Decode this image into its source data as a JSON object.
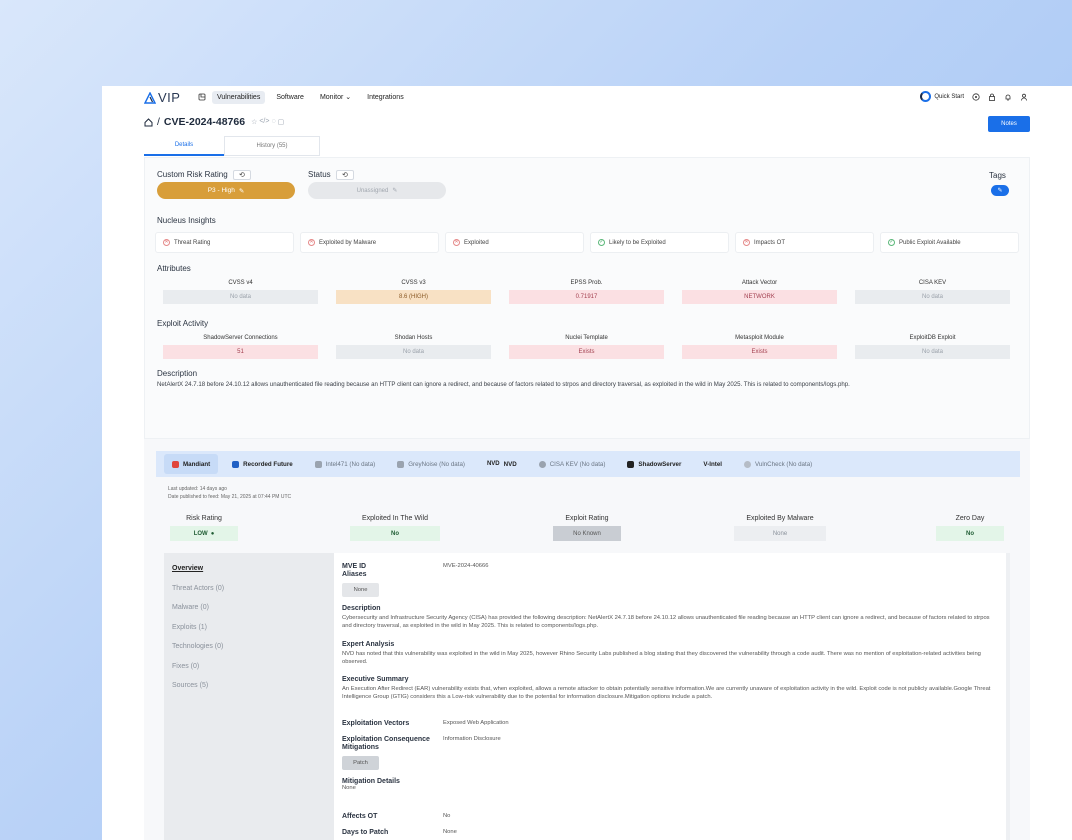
{
  "app": {
    "brand": "VIP"
  },
  "nav": {
    "items": [
      "Vulnerabilities",
      "Software",
      "Monitor",
      "Integrations"
    ],
    "quick_start": "Quick Start"
  },
  "header": {
    "cve_id": "CVE-2024-48766",
    "notes_label": "Notes"
  },
  "tabs": [
    {
      "label": "Details"
    },
    {
      "label": "History (55)"
    }
  ],
  "details": {
    "custom_risk_label": "Custom Risk Rating",
    "custom_risk_value": "P3 - High",
    "status_label": "Status",
    "status_value": "Unassigned",
    "tags_label": "Tags",
    "insights_label": "Nucleus Insights",
    "insights": [
      {
        "label": "Threat Rating",
        "state": "no"
      },
      {
        "label": "Exploited by Malware",
        "state": "no"
      },
      {
        "label": "Exploited",
        "state": "no"
      },
      {
        "label": "Likely to be Exploited",
        "state": "yes"
      },
      {
        "label": "Impacts OT",
        "state": "no"
      },
      {
        "label": "Public Exploit Available",
        "state": "yes"
      }
    ],
    "attributes_label": "Attributes",
    "attributes": [
      {
        "label": "CVSS v4",
        "value": "No data"
      },
      {
        "label": "CVSS v3",
        "value": "8.6 (HIGH)"
      },
      {
        "label": "EPSS Prob.",
        "value": "0.71917"
      },
      {
        "label": "Attack Vector",
        "value": "NETWORK"
      },
      {
        "label": "CISA KEV",
        "value": "No data"
      }
    ],
    "exploit_label": "Exploit Activity",
    "exploit": [
      {
        "label": "ShadowServer Connections",
        "value": "51"
      },
      {
        "label": "Shodan Hosts",
        "value": "No data"
      },
      {
        "label": "Nuclei Template",
        "value": "Exists"
      },
      {
        "label": "Metasploit Module",
        "value": "Exists"
      },
      {
        "label": "ExploitDB Exploit",
        "value": "No data"
      }
    ],
    "description_label": "Description",
    "description": "NetAlertX 24.7.18 before 24.10.12 allows unauthenticated file reading because an HTTP client can ignore a redirect, and because of factors related to strpos and directory traversal, as exploited in the wild in May 2025. This is related to components/logs.php."
  },
  "sources": {
    "tabs": [
      "Mandiant",
      "Recorded Future",
      "Intel471 (No data)",
      "GreyNoise (No data)",
      "NVD",
      "CISA KEV (No data)",
      "ShadowServer",
      "V-Intel",
      "VulnCheck (No data)"
    ],
    "last_updated": "Last updated: 14 days ago",
    "published": "Date published to feed: May 21, 2025 at 07:44 PM UTC",
    "ratings": [
      {
        "label": "Risk Rating",
        "value": "LOW"
      },
      {
        "label": "Exploited In The Wild",
        "value": "No"
      },
      {
        "label": "Exploit Rating",
        "value": "No Known"
      },
      {
        "label": "Exploited By Malware",
        "value": "None"
      },
      {
        "label": "Zero Day",
        "value": "No"
      }
    ],
    "sidenav": [
      "Overview",
      "Threat Actors (0)",
      "Malware (0)",
      "Exploits (1)",
      "Technologies (0)",
      "Fixes (0)",
      "Sources (5)"
    ],
    "overview": {
      "mve_id_label": "MVE ID",
      "mve_id": "MVE-2024-40666",
      "aliases_label": "Aliases",
      "aliases": "None",
      "description_label": "Description",
      "description": "Cybersecurity and Infrastructure Security Agency (CISA) has provided the following description: NetAlertX 24.7.18 before 24.10.12 allows unauthenticated file reading because an HTTP client can ignore a redirect, and because of factors related to strpos and directory traversal, as exploited in the wild in May 2025. This is related to components/logs.php.",
      "expert_label": "Expert Analysis",
      "expert": "NVD has noted that this vulnerability was exploited in the wild in May 2025, however Rhino Security Labs published a blog stating that they discovered the vulnerability through a code audit. There was no mention of exploitation-related activities being observed.",
      "exec_label": "Executive Summary",
      "exec": "An Execution After Redirect (EAR) vulnerability exists that, when exploited, allows a remote attacker to obtain potentially sensitive information.We are currently unaware of exploitation activity in the wild. Exploit code is not publicly available.Google Threat Intelligence Group (GTIG) considers this a Low-risk vulnerability due to the potential for information disclosure.Mitigation options include a patch.",
      "vectors_label": "Exploitation Vectors",
      "vectors": "Exposed Web Application",
      "consequence_label": "Exploitation Consequence",
      "consequence": "Information Disclosure",
      "mitigations_label": "Mitigations",
      "mitigations": "Patch",
      "mit_details_label": "Mitigation Details",
      "mit_details": "None",
      "affects_ot_label": "Affects OT",
      "affects_ot": "No",
      "days_patch_label": "Days to Patch",
      "days_patch": "None"
    }
  }
}
